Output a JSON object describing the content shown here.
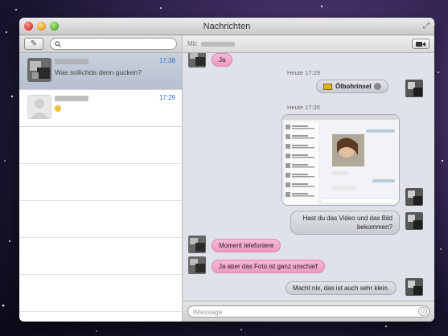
{
  "window": {
    "title": "Nachrichten"
  },
  "sidebar": {
    "search_placeholder": "",
    "conversations": [
      {
        "time": "17:38",
        "preview": "Was sollichda denn gucken?"
      },
      {
        "time": "17:29",
        "preview": ""
      }
    ]
  },
  "header": {
    "to_label": "Mit:"
  },
  "thread": {
    "messages": [
      {
        "direction": "in",
        "text": "Ja"
      },
      {
        "type": "timestamp",
        "text": "Heute 17:29"
      },
      {
        "direction": "out",
        "type": "file",
        "text": "Ölbohrinsel"
      },
      {
        "type": "timestamp",
        "text": "Heute 17:35"
      },
      {
        "direction": "out",
        "type": "image"
      },
      {
        "direction": "out",
        "text": "Hast du das Video und das Bild bekommen?"
      },
      {
        "direction": "in",
        "text": "Moment telefoniere"
      },
      {
        "direction": "in",
        "text": "Ja aber das Foto ist ganz unscharf"
      },
      {
        "direction": "out",
        "text": "Macht nix, das ist auch sehr klein."
      }
    ]
  },
  "input": {
    "placeholder": "iMessage"
  },
  "icons": {
    "compose": "compose-icon",
    "search": "search-icon",
    "video": "video-camera-icon",
    "emoji": "smiley-icon"
  }
}
